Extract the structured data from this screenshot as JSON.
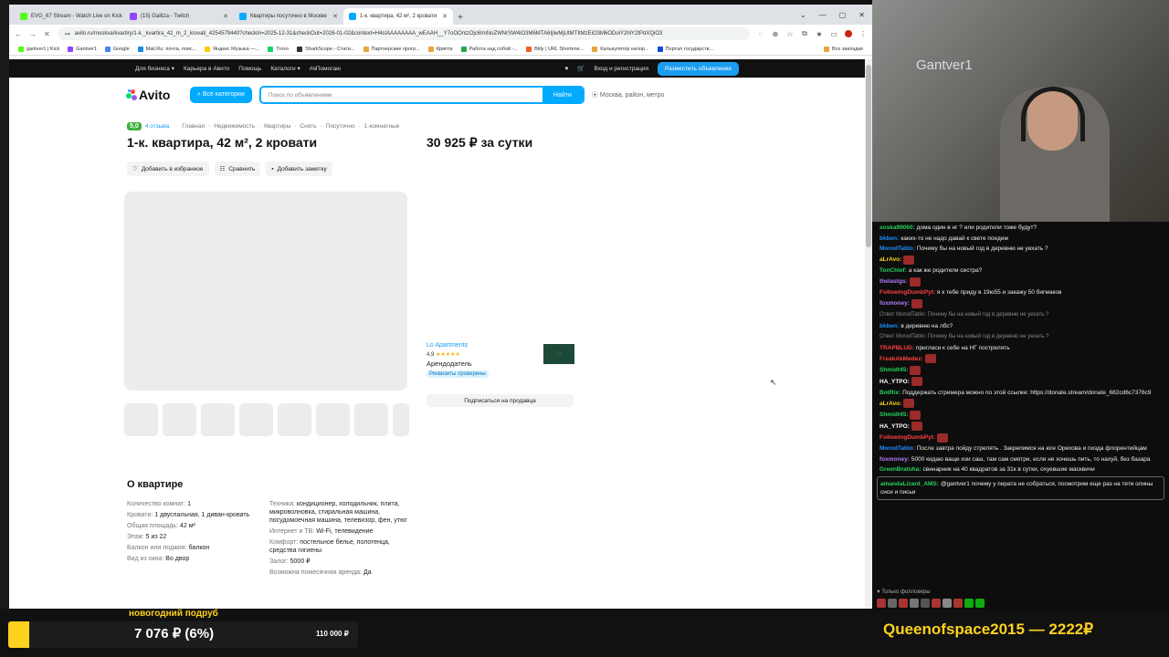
{
  "browser": {
    "tabs": [
      {
        "label": "EVG_67 Stream - Watch Live on Kick",
        "color": "#53fc18"
      },
      {
        "label": "(15) Galitza - Twitch",
        "color": "#9146ff"
      },
      {
        "label": "Квартиры посуточно в Москве",
        "color": "#00aaff"
      },
      {
        "label": "1-к. квартира, 42 м², 2 кровати",
        "color": "#00aaff"
      }
    ],
    "new_tab": "+",
    "url": "avito.ru/moskva/kvartiry/1-k._kvartira_42_m_2_krovati_4254579440?checkIn=2025-12-31&checkOut=2026-01-02&context=H4sIAAAAAAAA_wEAAH__Y7oOOntzOjc6ImNoZWNrSW4iO3M6MTA6IjIwMjUtMTItMzEiO3M6ODoiY2hlY2tPdXQiO3",
    "bookmarks": [
      {
        "label": "gantver1 | Kick",
        "color": "#53fc18"
      },
      {
        "label": "Gantver1",
        "color": "#9146ff"
      },
      {
        "label": "Google",
        "color": "#4285f4"
      },
      {
        "label": "Mail.Ru: почта, поис...",
        "color": "#168de2"
      },
      {
        "label": "Яндекс Музыка —...",
        "color": "#ffcc00"
      },
      {
        "label": "Trovo",
        "color": "#19d66b"
      },
      {
        "label": "SharkScope - Стати...",
        "color": "#333333"
      },
      {
        "label": "Партнерские прогр...",
        "color": "#e8a33d"
      },
      {
        "label": "Крипта",
        "color": "#e8a33d"
      },
      {
        "label": "Работа над собой -...",
        "color": "#2aa150"
      },
      {
        "label": "Bitly | URL Shortene...",
        "color": "#ee6123"
      },
      {
        "label": "Калькулятор калор...",
        "color": "#e8a33d"
      },
      {
        "label": "Портал государств...",
        "color": "#0d4cd3"
      },
      {
        "label": "Все закладки",
        "color": "#e8a33d"
      }
    ]
  },
  "avito": {
    "topnav": [
      "Для бизнеса ▾",
      "Карьера в Авито",
      "Помощь",
      "Каталоги ▾",
      "#яПомогаю"
    ],
    "login": "Вход и регистрация",
    "post_ad": "Разместить объявление",
    "logo": "Avito",
    "categories": "Все категории",
    "search_placeholder": "Поиск по объявлениям",
    "search_button": "Найти",
    "location": "Москва, район, метро",
    "rating": "5,0",
    "reviews": "4 отзыва",
    "breadcrumbs": [
      "Главная",
      "Недвижимость",
      "Квартиры",
      "Снять",
      "Посуточно",
      "1-комнатные"
    ],
    "title": "1-к. квартира, 42 м², 2 кровати",
    "price": "30 925 ₽ за сутки",
    "actions": [
      "Добавить в избранное",
      "Сравнить",
      "Добавить заметку"
    ],
    "seller": {
      "name": "Lo Apartments",
      "rating": "4,9",
      "stars": "★★★★★",
      "role": "Арендодатель",
      "badge": "Реквизиты проверены",
      "avatar_text": "Lo"
    },
    "subscribe": "Подписаться на продавца",
    "about_title": "О квартире",
    "about_left": [
      {
        "k": "Количество комнат:",
        "v": "1"
      },
      {
        "k": "Кровати:",
        "v": "1 двуспальная, 1 диван-кровать"
      },
      {
        "k": "Общая площадь:",
        "v": "42 м²"
      },
      {
        "k": "Этаж:",
        "v": "5 из 22"
      },
      {
        "k": "Балкон или лоджия:",
        "v": "балкон"
      },
      {
        "k": "Вид из окна:",
        "v": "Во двор"
      }
    ],
    "about_right": [
      {
        "k": "Техника:",
        "v": "кондиционер, холодильник, плита, микроволновка, стиральная машина, посудомоечная машина, телевизор, фен, утюг"
      },
      {
        "k": "Интернет и ТВ:",
        "v": "Wi-Fi, телевидение"
      },
      {
        "k": "Комфорт:",
        "v": "постельное белье, полотенца, средства гигиены"
      },
      {
        "k": "Залог:",
        "v": "5000 ₽"
      },
      {
        "k": "Возможна помесячная аренда:",
        "v": "Да"
      }
    ]
  },
  "stream": {
    "cam_name": "Gantver1",
    "goal_title": "новогодний подруб",
    "goal_value": "7 076 ₽ (6%)",
    "goal_target": "110 000 ₽",
    "goal_progress": 0.06,
    "donor": "Queenofspace2015 — 2222₽",
    "followers_only": "Только фолловеры"
  },
  "chat": [
    {
      "user": "soska99060:",
      "color": "#27d35f",
      "text": "дома один в нг ? или родители тоже будут?"
    },
    {
      "user": "bkben:",
      "color": "#1e90ff",
      "text": "каких-то не надо давай к свете поедем"
    },
    {
      "user": "MorodTablo:",
      "color": "#1e90ff",
      "text": "Почему бы на новый год в деревню не уехать ?"
    },
    {
      "user": "aLrAvo:",
      "color": "#ffd21f",
      "text": ""
    },
    {
      "user": "TonChief:",
      "color": "#27d35f",
      "text": "а как же родители сестра?"
    },
    {
      "user": "thelastgs:",
      "color": "#b37bff",
      "text": ""
    },
    {
      "user": "FollowingDumbPyt:",
      "color": "#ff4040",
      "text": "я к тебе приду в 19ю55 и закажу 50 бигмаков"
    },
    {
      "user": "foxmoney:",
      "color": "#b37bff",
      "text": ""
    },
    {
      "reply": "Ответ MorodTablo: Почему бы на новый год в деревню не уехать ?"
    },
    {
      "user": "bkben:",
      "color": "#1e90ff",
      "text": "в деревню на лбс?"
    },
    {
      "reply": "Ответ MorodTablo: Почему бы на новый год в деревню не уехать ?"
    },
    {
      "user": "TRAPBLUD:",
      "color": "#ff4040",
      "text": "пригласи к себе на НГ пострелять"
    },
    {
      "user": "FreakAkMedez:",
      "color": "#ff4040",
      "text": ""
    },
    {
      "user": "Shmidt45:",
      "color": "#27d35f",
      "text": ""
    },
    {
      "user": "HA_YTPO:",
      "color": "#ffffff",
      "text": ""
    },
    {
      "user": "BotRix:",
      "color": "#27d35f",
      "text": "Поддержать стримера можно по этой ссылке: https://donate.stream/donate_682cd6c7376c9"
    },
    {
      "user": "aLrAvo:",
      "color": "#ffd21f",
      "text": ""
    },
    {
      "user": "Shmidt45:",
      "color": "#27d35f",
      "text": ""
    },
    {
      "user": "HA_YTPO:",
      "color": "#ffffff",
      "text": ""
    },
    {
      "user": "FollowingDumbPyt:",
      "color": "#ff4040",
      "text": ""
    },
    {
      "user": "MorodTablo:",
      "color": "#1e90ff",
      "text": "После завтра пойду стрелять . Закрепимся на юге Орехова и пизда флорентийцам"
    },
    {
      "user": "foxmoney:",
      "color": "#b37bff",
      "text": "5000 кидаю ваще изи саш, там сам смотри, если не хочешь пить, то нахуй, без базара"
    },
    {
      "user": "GreenBratuha:",
      "color": "#27d35f",
      "text": "свинарник на 40 квадратов за 31к в сутки, охуевшие масквичи"
    },
    {
      "user": "amandaLizard_AMS:",
      "color": "#27d35f",
      "text": "@gantver1 почему у пирата не собраться, посмотрим еще раз на тети олины сиси и письи",
      "hl": true
    }
  ]
}
